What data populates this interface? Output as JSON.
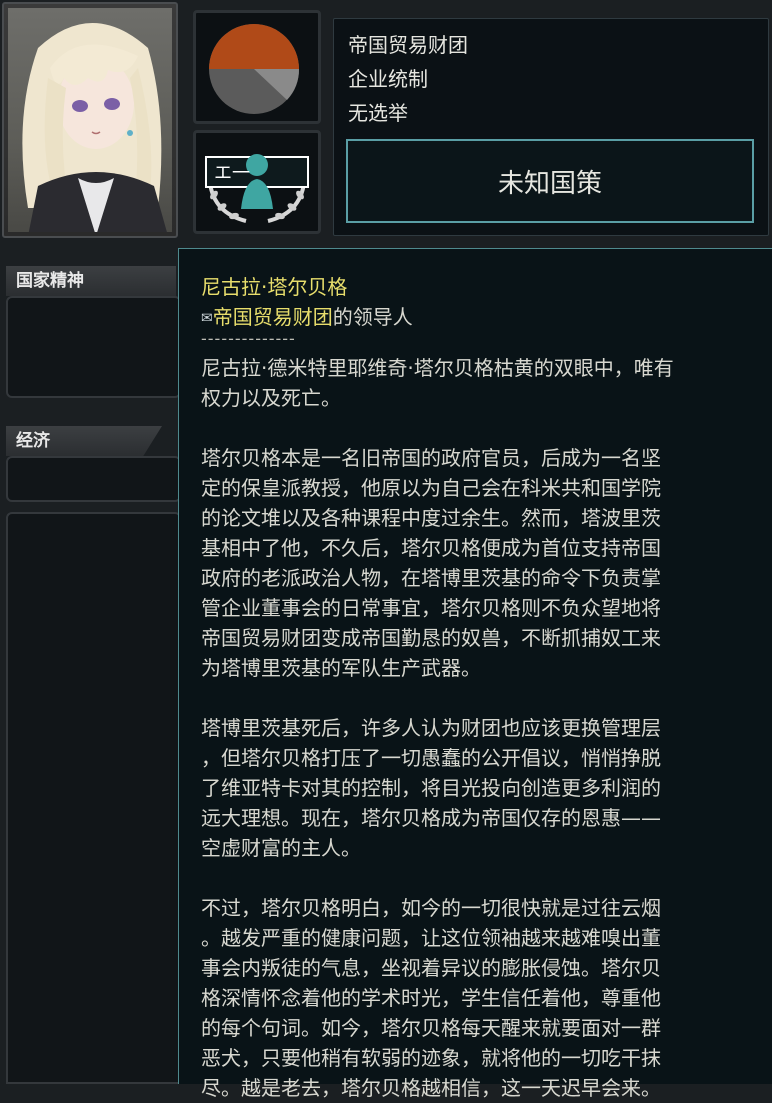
{
  "leader": {
    "portrait_icon": "leader-portrait"
  },
  "ideology_chart": {
    "colors": {
      "primary": "#b04a18",
      "secondary": "#5b5b5b",
      "tertiary": "#8a8a8a"
    }
  },
  "party_emblem": {
    "icon": "party-emblem-icon",
    "text": "エ一"
  },
  "country_info": {
    "party_name": "帝国贸易财团",
    "ideology": "企业统制",
    "elections": "无选举",
    "focus_label": "未知国策"
  },
  "sections": {
    "national_spirit": "国家精神",
    "economy": "经济"
  },
  "tooltip": {
    "name": "尼古拉·塔尔贝格",
    "role_org": "帝国贸易财团",
    "role_suffix": "的领导人",
    "separator": "--------------",
    "body": "尼古拉·德米特里耶维奇·塔尔贝格枯黄的双眼中，唯有\n权力以及死亡。\n\n塔尔贝格本是一名旧帝国的政府官员，后成为一名坚\n定的保皇派教授，他原以为自己会在科米共和国学院\n的论文堆以及各种课程中度过余生。然而，塔波里茨\n基相中了他，不久后，塔尔贝格便成为首位支持帝国\n政府的老派政治人物，在塔博里茨基的命令下负责掌\n管企业董事会的日常事宜，塔尔贝格则不负众望地将\n帝国贸易财团变成帝国勤恳的奴兽，不断抓捕奴工来\n为塔博里茨基的军队生产武器。\n\n塔博里茨基死后，许多人认为财团也应该更换管理层\n，但塔尔贝格打压了一切愚蠢的公开倡议，悄悄挣脱\n了维亚特卡对其的控制，将目光投向创造更多利润的\n远大理想。现在，塔尔贝格成为帝国仅存的恩惠——\n空虚财富的主人。\n\n不过，塔尔贝格明白，如今的一切很快就是过往云烟\n。越发严重的健康问题，让这位领袖越来越难嗅出董\n事会内叛徒的气息，坐视着异议的膨胀侵蚀。塔尔贝\n格深情怀念着他的学术时光，学生信任着他，尊重他\n的每个句词。如今，塔尔贝格每天醒来就要面对一群\n恶犬，只要他稍有软弱的迹象，就将他的一切吃干抹\n尽。越是老去，塔尔贝格越相信，这一天迟早会来。"
  }
}
